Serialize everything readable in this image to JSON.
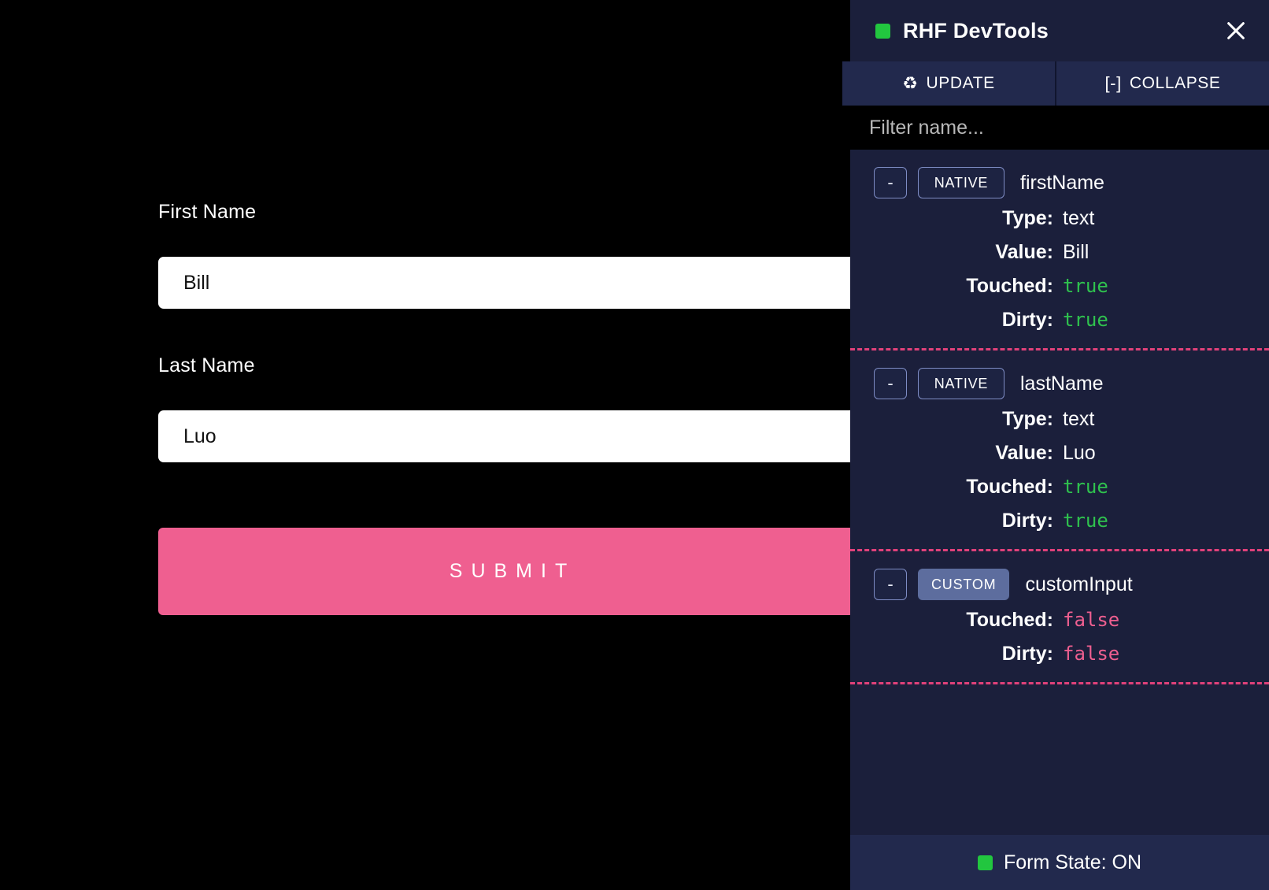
{
  "form": {
    "fields": [
      {
        "label": "First Name",
        "value": "Bill",
        "placeholder": ""
      },
      {
        "label": "Last Name",
        "value": "Luo",
        "placeholder": ""
      }
    ],
    "submit_label": "SUBMIT",
    "submit_color": "#ef5f90"
  },
  "devtools": {
    "title": "RHF DevTools",
    "status_color": "#22c63f",
    "close_icon": "close-icon",
    "tabs": [
      {
        "label": "UPDATE",
        "glyph": "♻"
      },
      {
        "label": "COLLAPSE",
        "glyph": "[-]"
      }
    ],
    "filter": {
      "value": "",
      "placeholder": "Filter name..."
    },
    "collapse_button_label": "-",
    "fields": [
      {
        "name": "firstName",
        "kind": "NATIVE",
        "rows": [
          {
            "key": "Type:",
            "value": "text",
            "style": "plain"
          },
          {
            "key": "Value:",
            "value": "Bill",
            "style": "plain"
          },
          {
            "key": "Touched:",
            "value": "true",
            "style": "true"
          },
          {
            "key": "Dirty:",
            "value": "true",
            "style": "true"
          }
        ]
      },
      {
        "name": "lastName",
        "kind": "NATIVE",
        "rows": [
          {
            "key": "Type:",
            "value": "text",
            "style": "plain"
          },
          {
            "key": "Value:",
            "value": "Luo",
            "style": "plain"
          },
          {
            "key": "Touched:",
            "value": "true",
            "style": "true"
          },
          {
            "key": "Dirty:",
            "value": "true",
            "style": "true"
          }
        ]
      },
      {
        "name": "customInput",
        "kind": "CUSTOM",
        "rows": [
          {
            "key": "Touched:",
            "value": "false",
            "style": "false"
          },
          {
            "key": "Dirty:",
            "value": "false",
            "style": "false"
          }
        ]
      }
    ],
    "footer": {
      "label": "Form State: ON",
      "status_color": "#22c63f"
    },
    "divider_color": "#e0417a"
  }
}
